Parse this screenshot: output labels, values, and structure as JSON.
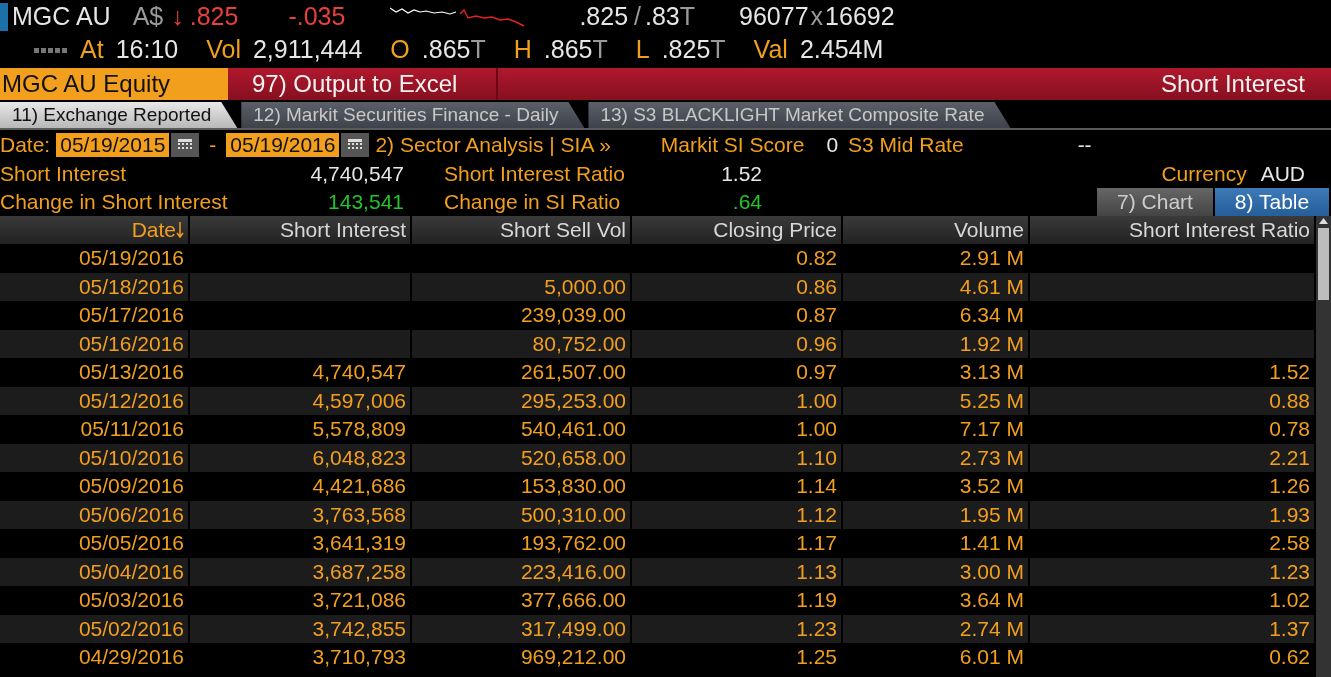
{
  "quote": {
    "ticker": "MGC AU",
    "currency": "A$",
    "arrow": "↓",
    "last": ".825",
    "change": "-.035",
    "bid": ".825",
    "separator": "/",
    "ask": ".83",
    "ask_flag": "T",
    "bid_size": "96077",
    "size_separator": "x",
    "ask_size": "16692"
  },
  "stats": [
    {
      "label": "At",
      "value": "16:10"
    },
    {
      "label": "Vol",
      "value": "2,911,444"
    },
    {
      "label": "O",
      "value": ".865",
      "flag": "T"
    },
    {
      "label": "H",
      "value": ".865",
      "flag": "T"
    },
    {
      "label": "L",
      "value": ".825",
      "flag": "T"
    },
    {
      "label": "Val",
      "value": "2.454M"
    }
  ],
  "menu_bar": {
    "security": "MGC AU Equity",
    "action": "97) Output to Excel",
    "title": "Short Interest"
  },
  "tabs": [
    {
      "label": "11) Exchange Reported",
      "selected": true
    },
    {
      "label": "12) Markit Securities Finance - Daily",
      "selected": false
    },
    {
      "label": "13) S3 BLACKLIGHT Market Composite Rate",
      "selected": false
    }
  ],
  "filters": {
    "date_label": "Date:",
    "start": "05/19/2015",
    "dash": "-",
    "end": "05/19/2016",
    "link": "2) Sector Analysis | SIA »",
    "score_label": "Markit SI Score",
    "score": "0",
    "rate_label": "S3 Mid Rate",
    "rate": "--"
  },
  "summary_left": [
    {
      "label": "Short Interest",
      "value": "4,740,547",
      "kind": "plain"
    },
    {
      "label": "Change in Short Interest",
      "value": "143,541",
      "kind": "change"
    }
  ],
  "summary_right": [
    {
      "label": "Short Interest Ratio",
      "value": "1.52",
      "kind": "plain"
    },
    {
      "label": "Change in SI Ratio",
      "value": ".64",
      "kind": "change"
    }
  ],
  "currency": {
    "label": "Currency",
    "value": "AUD"
  },
  "view_toggle": [
    {
      "label": "7) Chart",
      "selected": false
    },
    {
      "label": "8) Table",
      "selected": true
    }
  ],
  "table": {
    "columns": [
      {
        "label": "Date",
        "sorted": true
      },
      {
        "label": "Short Interest",
        "sorted": false
      },
      {
        "label": "Short Sell Vol",
        "sorted": false
      },
      {
        "label": "Closing Price",
        "sorted": false
      },
      {
        "label": "Volume",
        "sorted": false
      },
      {
        "label": "Short Interest Ratio",
        "sorted": false
      }
    ],
    "rows": [
      {
        "date": "05/19/2016",
        "closing_price": "0.82",
        "volume": "2.91 M"
      },
      {
        "date": "05/18/2016",
        "short_sell_vol": "5,000.00",
        "closing_price": "0.86",
        "volume": "4.61 M"
      },
      {
        "date": "05/17/2016",
        "short_sell_vol": "239,039.00",
        "closing_price": "0.87",
        "volume": "6.34 M"
      },
      {
        "date": "05/16/2016",
        "short_sell_vol": "80,752.00",
        "closing_price": "0.96",
        "volume": "1.92 M"
      },
      {
        "date": "05/13/2016",
        "short_interest": "4,740,547",
        "short_sell_vol": "261,507.00",
        "closing_price": "0.97",
        "volume": "3.13 M",
        "ratio": "1.52"
      },
      {
        "date": "05/12/2016",
        "short_interest": "4,597,006",
        "short_sell_vol": "295,253.00",
        "closing_price": "1.00",
        "volume": "5.25 M",
        "ratio": "0.88"
      },
      {
        "date": "05/11/2016",
        "short_interest": "5,578,809",
        "short_sell_vol": "540,461.00",
        "closing_price": "1.00",
        "volume": "7.17 M",
        "ratio": "0.78"
      },
      {
        "date": "05/10/2016",
        "short_interest": "6,048,823",
        "short_sell_vol": "520,658.00",
        "closing_price": "1.10",
        "volume": "2.73 M",
        "ratio": "2.21"
      },
      {
        "date": "05/09/2016",
        "short_interest": "4,421,686",
        "short_sell_vol": "153,830.00",
        "closing_price": "1.14",
        "volume": "3.52 M",
        "ratio": "1.26"
      },
      {
        "date": "05/06/2016",
        "short_interest": "3,763,568",
        "short_sell_vol": "500,310.00",
        "closing_price": "1.12",
        "volume": "1.95 M",
        "ratio": "1.93"
      },
      {
        "date": "05/05/2016",
        "short_interest": "3,641,319",
        "short_sell_vol": "193,762.00",
        "closing_price": "1.17",
        "volume": "1.41 M",
        "ratio": "2.58"
      },
      {
        "date": "05/04/2016",
        "short_interest": "3,687,258",
        "short_sell_vol": "223,416.00",
        "closing_price": "1.13",
        "volume": "3.00 M",
        "ratio": "1.23"
      },
      {
        "date": "05/03/2016",
        "short_interest": "3,721,086",
        "short_sell_vol": "377,666.00",
        "closing_price": "1.19",
        "volume": "3.64 M",
        "ratio": "1.02"
      },
      {
        "date": "05/02/2016",
        "short_interest": "3,742,855",
        "short_sell_vol": "317,499.00",
        "closing_price": "1.23",
        "volume": "2.74 M",
        "ratio": "1.37"
      },
      {
        "date": "04/29/2016",
        "short_interest": "3,710,793",
        "short_sell_vol": "969,212.00",
        "closing_price": "1.25",
        "volume": "6.01 M",
        "ratio": "0.62"
      }
    ]
  }
}
